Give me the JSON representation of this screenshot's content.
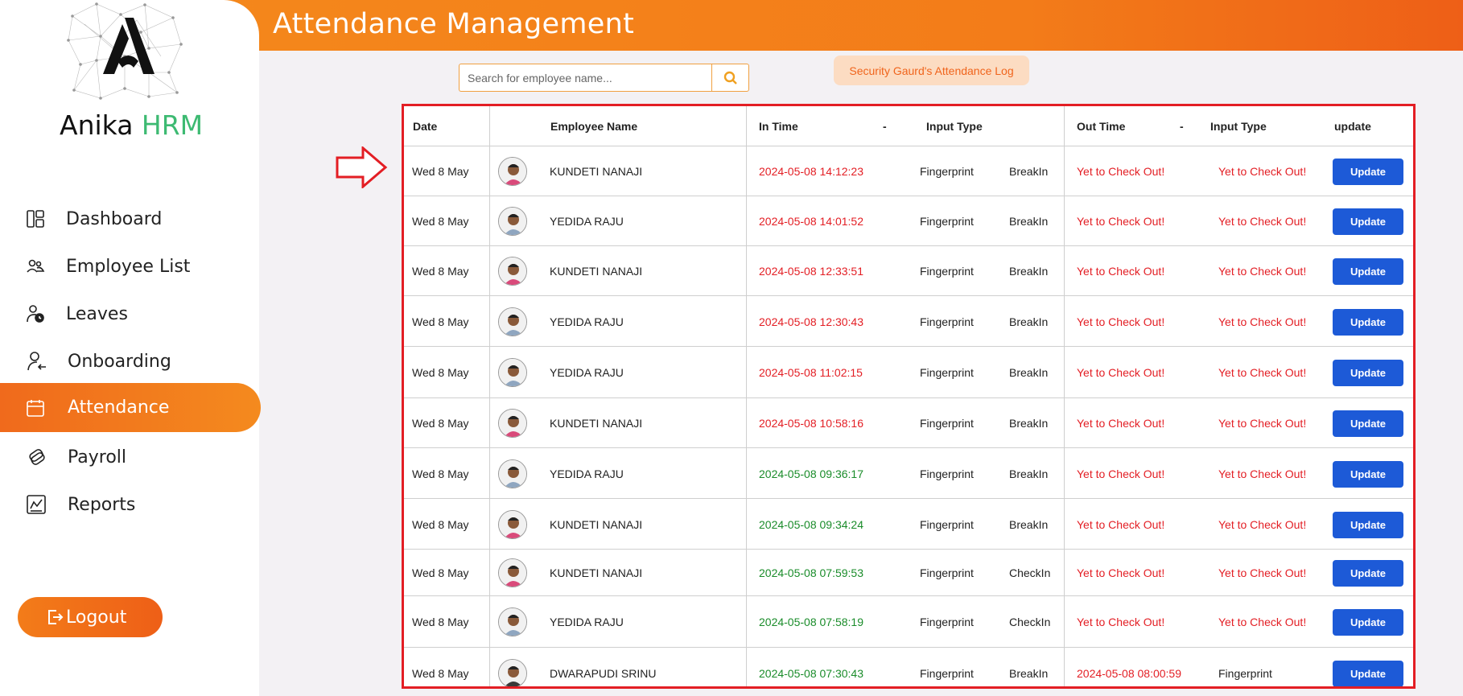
{
  "header": {
    "title": "Attendance Management"
  },
  "brand": {
    "name_part1": "Anika ",
    "name_part2": "HRM"
  },
  "sidebar": {
    "items": [
      {
        "label": "Dashboard",
        "icon": "dashboard-icon"
      },
      {
        "label": "Employee List",
        "icon": "users-icon"
      },
      {
        "label": "Leaves",
        "icon": "user-clock-icon"
      },
      {
        "label": "Onboarding",
        "icon": "user-arrow-icon"
      },
      {
        "label": "Attendance",
        "icon": "calendar-icon",
        "active": true
      },
      {
        "label": "Payroll",
        "icon": "money-icon"
      },
      {
        "label": "Reports",
        "icon": "chart-icon"
      }
    ],
    "logout_label": "Logout"
  },
  "search": {
    "placeholder": "Search for employee name...",
    "value": ""
  },
  "security_log_label": "Security Gaurd's Attendance Log",
  "table": {
    "headers": {
      "date": "Date",
      "employee_name": "Employee Name",
      "in_time": "In Time",
      "dash1": "-",
      "input_type1": "Input Type",
      "out_time": "Out Time",
      "dash2": "-",
      "input_type2": "Input Type",
      "update": "update"
    },
    "rows": [
      {
        "date": "Wed 8 May",
        "name": "KUNDETI NANAJI",
        "in_time": "2024-05-08 14:12:23",
        "in_color": "red",
        "input_type": "Fingerprint",
        "event": "BreakIn",
        "out_time": "Yet to Check Out!",
        "out_type": "Yet to Check Out!",
        "button": "Update"
      },
      {
        "date": "Wed 8 May",
        "name": "YEDIDA RAJU",
        "in_time": "2024-05-08 14:01:52",
        "in_color": "red",
        "input_type": "Fingerprint",
        "event": "BreakIn",
        "out_time": "Yet to Check Out!",
        "out_type": "Yet to Check Out!",
        "button": "Update"
      },
      {
        "date": "Wed 8 May",
        "name": "KUNDETI NANAJI",
        "in_time": "2024-05-08 12:33:51",
        "in_color": "red",
        "input_type": "Fingerprint",
        "event": "BreakIn",
        "out_time": "Yet to Check Out!",
        "out_type": "Yet to Check Out!",
        "button": "Update"
      },
      {
        "date": "Wed 8 May",
        "name": "YEDIDA RAJU",
        "in_time": "2024-05-08 12:30:43",
        "in_color": "red",
        "input_type": "Fingerprint",
        "event": "BreakIn",
        "out_time": "Yet to Check Out!",
        "out_type": "Yet to Check Out!",
        "button": "Update"
      },
      {
        "date": "Wed 8 May",
        "name": "YEDIDA RAJU",
        "in_time": "2024-05-08 11:02:15",
        "in_color": "red",
        "input_type": "Fingerprint",
        "event": "BreakIn",
        "out_time": "Yet to Check Out!",
        "out_type": "Yet to Check Out!",
        "button": "Update"
      },
      {
        "date": "Wed 8 May",
        "name": "KUNDETI NANAJI",
        "in_time": "2024-05-08 10:58:16",
        "in_color": "red",
        "input_type": "Fingerprint",
        "event": "BreakIn",
        "out_time": "Yet to Check Out!",
        "out_type": "Yet to Check Out!",
        "button": "Update"
      },
      {
        "date": "Wed 8 May",
        "name": "YEDIDA RAJU",
        "in_time": "2024-05-08 09:36:17",
        "in_color": "green",
        "input_type": "Fingerprint",
        "event": "BreakIn",
        "out_time": "Yet to Check Out!",
        "out_type": "Yet to Check Out!",
        "button": "Update"
      },
      {
        "date": "Wed 8 May",
        "name": "KUNDETI NANAJI",
        "in_time": "2024-05-08 09:34:24",
        "in_color": "green",
        "input_type": "Fingerprint",
        "event": "BreakIn",
        "out_time": "Yet to Check Out!",
        "out_type": "Yet to Check Out!",
        "button": "Update"
      },
      {
        "date": "Wed 8 May",
        "name": "KUNDETI NANAJI",
        "in_time": "2024-05-08 07:59:53",
        "in_color": "green",
        "input_type": "Fingerprint",
        "event": "CheckIn",
        "out_time": "Yet to Check Out!",
        "out_type": "Yet to Check Out!",
        "button": "Update"
      },
      {
        "date": "Wed 8 May",
        "name": "YEDIDA RAJU",
        "in_time": "2024-05-08 07:58:19",
        "in_color": "green",
        "input_type": "Fingerprint",
        "event": "CheckIn",
        "out_time": "Yet to Check Out!",
        "out_type": "Yet to Check Out!",
        "button": "Update"
      },
      {
        "date": "Wed 8 May",
        "name": "DWARAPUDI SRINU",
        "in_time": "2024-05-08 07:30:43",
        "in_color": "green",
        "input_type": "Fingerprint",
        "event": "BreakIn",
        "out_time": "2024-05-08 08:00:59",
        "out_type": "Fingerprint",
        "button": "Update"
      }
    ]
  },
  "colors": {
    "accent": "#f37c19",
    "brand_green": "#3dba72",
    "update_blue": "#1d5ad7",
    "late_red": "#e31e24",
    "ontime_green": "#1a8c2a"
  }
}
